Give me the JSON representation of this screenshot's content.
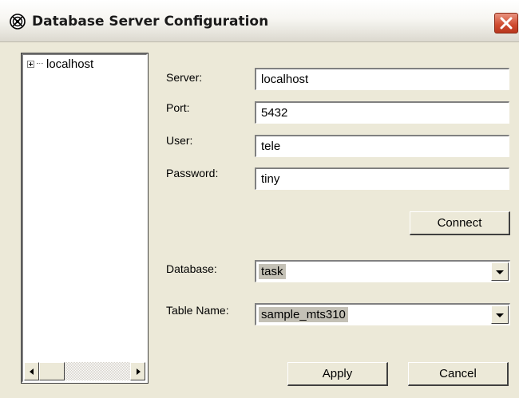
{
  "window": {
    "title": "Database Server Configuration"
  },
  "icons": {
    "app": "database-app-icon",
    "close": "close-icon",
    "expand": "plus-expander-icon",
    "scroll_left": "arrow-left-icon",
    "scroll_right": "arrow-right-icon",
    "dropdown": "chevron-down-icon"
  },
  "tree": {
    "items": [
      {
        "label": "localhost",
        "expanded": false
      }
    ]
  },
  "form": {
    "server": {
      "label": "Server:",
      "value": "localhost"
    },
    "port": {
      "label": "Port:",
      "value": "5432"
    },
    "user": {
      "label": "User:",
      "value": "tele"
    },
    "password": {
      "label": "Password:",
      "value": "tiny"
    },
    "connect_label": "Connect",
    "database": {
      "label": "Database:",
      "value": "task"
    },
    "table_name": {
      "label": "Table Name:",
      "value": "sample_mts310"
    }
  },
  "footer": {
    "apply_label": "Apply",
    "cancel_label": "Cancel"
  },
  "colors": {
    "window_bg": "#ece9d8",
    "close_red": "#cf4a2e",
    "selection": "#c4c1b6"
  }
}
